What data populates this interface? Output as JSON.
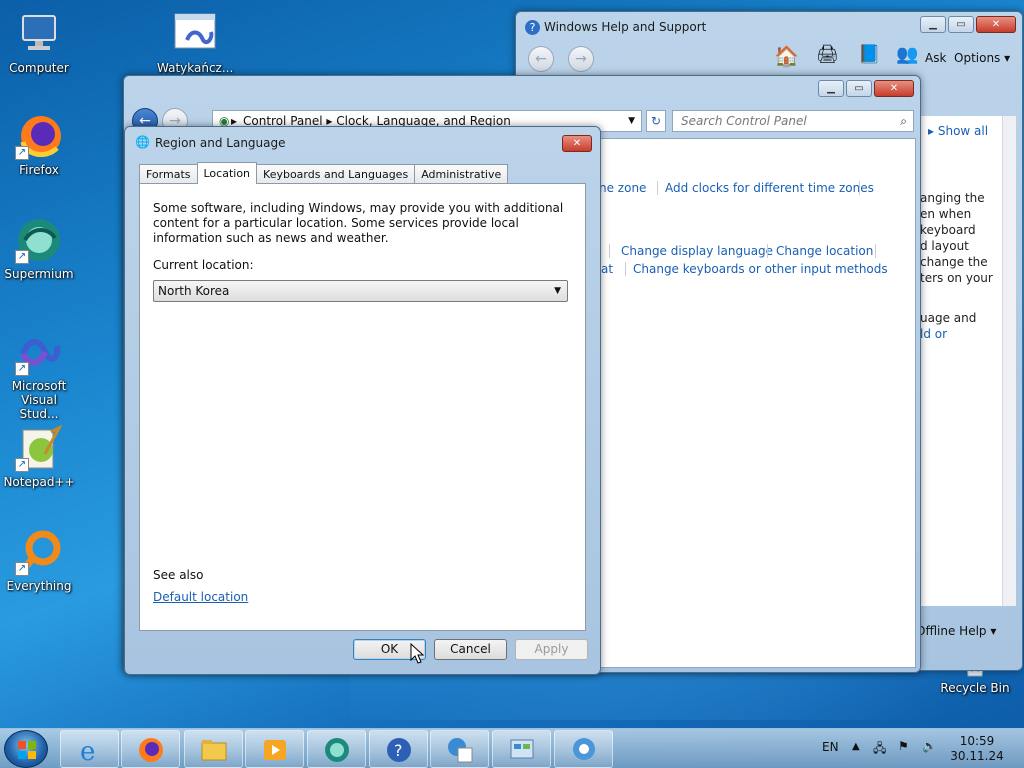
{
  "desktop": {
    "icons": [
      {
        "label": "Computer"
      },
      {
        "label": "Watykańcz..."
      },
      {
        "label": "Firefox"
      },
      {
        "label": "Supermium"
      },
      {
        "label": "Microsoft Visual Stud..."
      },
      {
        "label": "Notepad++"
      },
      {
        "label": "Everything"
      },
      {
        "label": "Recycle Bin"
      }
    ]
  },
  "help_window": {
    "title": "Windows Help and Support",
    "ask": "Ask",
    "options": "Options",
    "show_all": "Show all",
    "snippets": [
      "anging the",
      "en when",
      "keyboard",
      "d layout",
      "change the",
      "ters on your",
      "uage and",
      "ld or"
    ],
    "offline_help": "Offline Help"
  },
  "control_panel": {
    "breadcrumb_1": "Control Panel",
    "breadcrumb_2": "Clock, Language, and Region",
    "search_placeholder": "Search Control Panel",
    "links": {
      "time_zone": "ne zone",
      "add_clocks": "Add clocks for different time zones",
      "change_display_language": "Change display language",
      "change_location": "Change location",
      "at": "at",
      "change_keyboards": "Change keyboards or other input methods"
    }
  },
  "dialog": {
    "title": "Region and Language",
    "tabs": [
      "Formats",
      "Location",
      "Keyboards and Languages",
      "Administrative"
    ],
    "active_tab": "Location",
    "description": "Some software, including Windows, may provide you with additional content for a particular location. Some services provide local information such as news and weather.",
    "current_location_label": "Current location:",
    "current_location_value": "North Korea",
    "see_also": "See also",
    "default_location_link": "Default location",
    "ok": "OK",
    "cancel": "Cancel",
    "apply": "Apply"
  },
  "taskbar": {
    "language": "EN",
    "time": "10:59",
    "date": "30.11.24"
  }
}
